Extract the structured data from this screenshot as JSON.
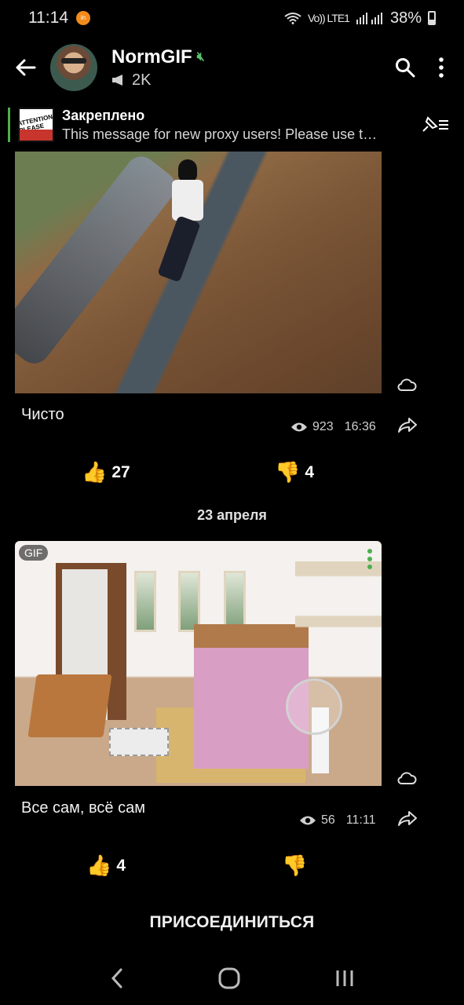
{
  "status_bar": {
    "time": "11:14",
    "network": "Vo)) LTE1",
    "battery": "38%"
  },
  "header": {
    "channel_name": "NormGIF",
    "subscribers": "2K"
  },
  "pinned": {
    "title": "Закреплено",
    "message": "This message for new proxy users! Please use t…"
  },
  "posts": [
    {
      "caption": "Чисто",
      "views": "923",
      "time": "16:36",
      "reactions": [
        {
          "emoji": "👍",
          "count": "27"
        },
        {
          "emoji": "👎",
          "count": "4"
        }
      ]
    },
    {
      "badge": "GIF",
      "caption": "Все сам, всё сам",
      "views": "56",
      "time": "11:11",
      "reactions": [
        {
          "emoji": "👍",
          "count": "4"
        },
        {
          "emoji": "👎",
          "count": ""
        }
      ]
    }
  ],
  "date_separator": "23 апреля",
  "join_button": "ПРИСОЕДИНИТЬСЯ",
  "colors": {
    "background": "#000000",
    "accent": "#4caf50"
  }
}
